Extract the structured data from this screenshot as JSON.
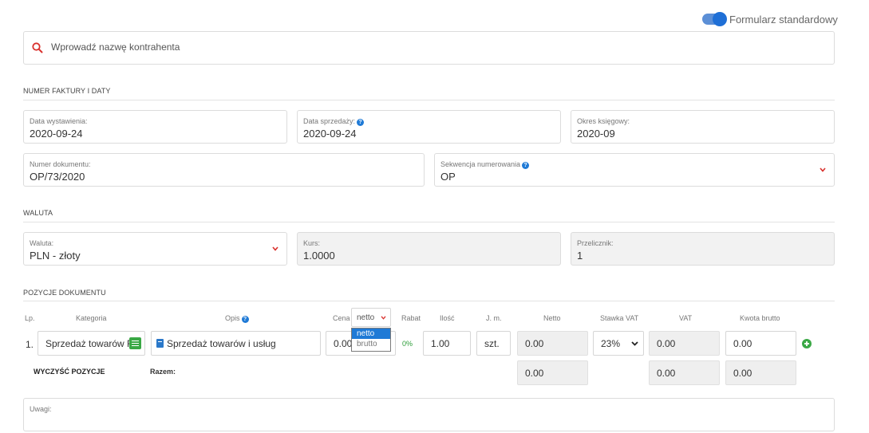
{
  "toggle": {
    "label": "Formularz standardowy",
    "on": true
  },
  "search": {
    "placeholder": "Wprowadź nazwę kontrahenta",
    "icon": "search-icon",
    "icon_color": "#d9302c"
  },
  "section_invoice": {
    "title": "NUMER FAKTURY I DATY"
  },
  "issue_date": {
    "label": "Data wystawienia:",
    "value": "2020-09-24"
  },
  "sale_date": {
    "label": "Data sprzedaży:",
    "value": "2020-09-24"
  },
  "accounting_period": {
    "label": "Okres księgowy:",
    "value": "2020-09"
  },
  "document_number": {
    "label": "Numer dokumentu:",
    "value": "OP/73/2020"
  },
  "numbering_sequence": {
    "label": "Sekwencja numerowania",
    "value": "OP"
  },
  "section_currency": {
    "title": "WALUTA"
  },
  "currency": {
    "label": "Waluta:",
    "value": "PLN - złoty"
  },
  "rate": {
    "label": "Kurs:",
    "value": "1.0000"
  },
  "converter": {
    "label": "Przelicznik:",
    "value": "1"
  },
  "section_items": {
    "title": "POZYCJE DOKUMENTU"
  },
  "columns": {
    "lp": "Lp.",
    "category": "Kategoria",
    "description": "Opis",
    "price": "Cena",
    "price_mode": "netto",
    "discount": "Rabat",
    "quantity": "Ilość",
    "unit": "J. m.",
    "net": "Netto",
    "vat_rate": "Stawka VAT",
    "vat": "VAT",
    "gross": "Kwota brutto"
  },
  "price_mode_options": [
    "netto",
    "brutto"
  ],
  "row": {
    "lp": "1.",
    "category": "Sprzedaż towarów FA",
    "description": "Sprzedaż towarów i usług",
    "price": "0.00",
    "discount": "0%",
    "quantity": "1.00",
    "unit": "szt.",
    "net": "0.00",
    "vat_rate": "23%",
    "vat": "0.00",
    "gross": "0.00"
  },
  "totals": {
    "clear_label": "WYCZYŚĆ POZYCJE",
    "sum_label": "Razem:",
    "net": "0.00",
    "vat": "0.00",
    "gross": "0.00"
  },
  "notes": {
    "label": "Uwagi:"
  },
  "colors": {
    "accent": "#1f6fd6",
    "danger": "#d9302c",
    "success": "#3aa845",
    "discount_green": "#2e9e3a"
  }
}
